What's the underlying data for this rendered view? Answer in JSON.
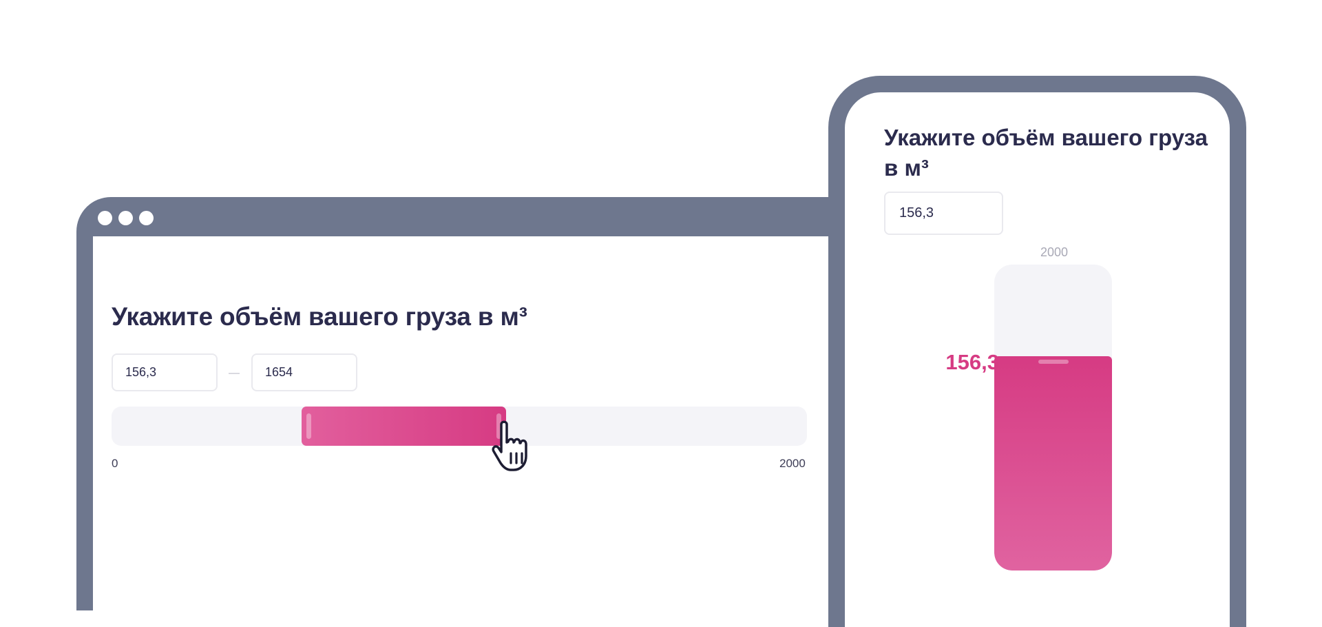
{
  "desktop": {
    "title": "Укажите объём вашего груза в м³",
    "range_min_value": "156,3",
    "range_max_value": "1654",
    "scale_min": "0",
    "scale_max": "2000",
    "slider": {
      "min": 0,
      "max": 2000,
      "selected_start_fraction": 0.273,
      "selected_end_fraction": 0.567
    }
  },
  "mobile": {
    "title": "Укажите объём вашего груза в м³",
    "value": "156,3",
    "scale_max": "2000",
    "value_label": "156,3",
    "slider": {
      "min": 0,
      "max": 2000,
      "fill_fraction": 0.7
    }
  },
  "colors": {
    "frame": "#6e778e",
    "accent": "#d63b83",
    "accent_light": "#e25f9d",
    "track": "#f4f4f8",
    "text": "#2b2b4d"
  },
  "icons": {
    "cursor": "hand-pointer-icon"
  }
}
